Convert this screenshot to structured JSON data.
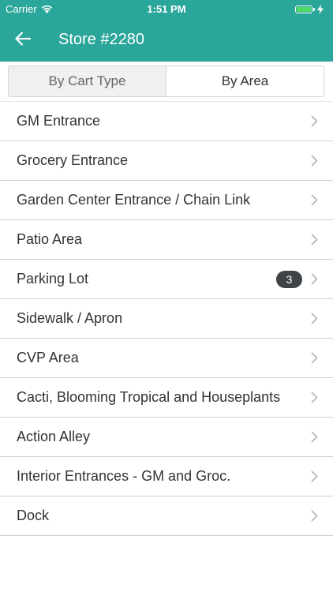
{
  "status_bar": {
    "carrier": "Carrier",
    "time": "1:51 PM"
  },
  "nav": {
    "title": "Store #2280"
  },
  "tabs": [
    {
      "label": "By Cart Type",
      "selected": false
    },
    {
      "label": "By Area",
      "selected": true
    }
  ],
  "areas": [
    {
      "label": "GM Entrance"
    },
    {
      "label": "Grocery Entrance"
    },
    {
      "label": "Garden Center Entrance / Chain Link"
    },
    {
      "label": "Patio Area"
    },
    {
      "label": "Parking Lot",
      "badge": "3"
    },
    {
      "label": "Sidewalk / Apron"
    },
    {
      "label": "CVP Area"
    },
    {
      "label": "Cacti, Blooming Tropical and Houseplants"
    },
    {
      "label": "Action Alley"
    },
    {
      "label": "Interior Entrances - GM and Groc."
    },
    {
      "label": "Dock"
    }
  ],
  "colors": {
    "header": "#2aa79a",
    "badge": "#3e4347",
    "battery": "#4cd964"
  }
}
